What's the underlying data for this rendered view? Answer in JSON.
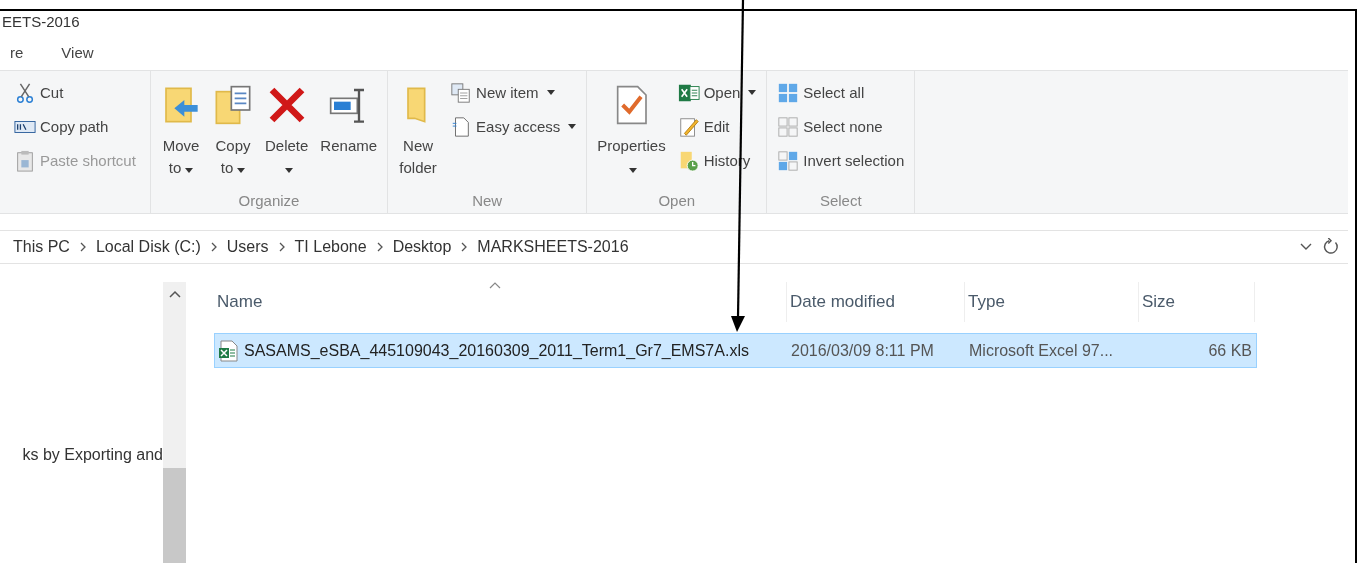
{
  "window": {
    "title": "EETS-2016"
  },
  "tabs": [
    {
      "label": "re",
      "selected": false
    },
    {
      "label": "View",
      "selected": false
    }
  ],
  "ribbon": {
    "groups": [
      {
        "items": [
          {
            "label": "Cut",
            "kind": "small",
            "disabled": false
          },
          {
            "label": "Copy path",
            "kind": "small",
            "disabled": false
          },
          {
            "label": "Paste shortcut",
            "kind": "small",
            "disabled": true
          }
        ]
      },
      {
        "label": "Organize",
        "items": [
          {
            "label": "Move to",
            "kind": "large",
            "dropdown": true
          },
          {
            "label": "Copy to",
            "kind": "large",
            "dropdown": true
          },
          {
            "label": "Delete",
            "kind": "large",
            "dropdown": true
          },
          {
            "label": "Rename",
            "kind": "large",
            "dropdown": false
          }
        ]
      },
      {
        "label": "New",
        "items": [
          {
            "label": "New folder",
            "kind": "large",
            "dropdown": false
          },
          {
            "label": "New item",
            "kind": "small",
            "dropdown": true,
            "disabled": false
          },
          {
            "label": "Easy access",
            "kind": "small",
            "dropdown": true,
            "disabled": false
          }
        ]
      },
      {
        "label": "Open",
        "items": [
          {
            "label": "Properties",
            "kind": "large",
            "dropdown": true
          },
          {
            "label": "Open",
            "kind": "small",
            "dropdown": true,
            "disabled": false
          },
          {
            "label": "Edit",
            "kind": "small",
            "disabled": false
          },
          {
            "label": "History",
            "kind": "small",
            "disabled": false
          }
        ]
      },
      {
        "label": "Select",
        "items": [
          {
            "label": "Select all",
            "kind": "small",
            "disabled": false
          },
          {
            "label": "Select none",
            "kind": "small",
            "disabled": false
          },
          {
            "label": "Invert selection",
            "kind": "small",
            "disabled": false
          }
        ]
      }
    ]
  },
  "address_bar": {
    "crumbs": [
      "This PC",
      "Local Disk (C:)",
      "Users",
      "TI Lebone",
      "Desktop",
      "MARKSHEETS-2016"
    ]
  },
  "navigation_pane": {
    "items": [
      "ks by Exporting and"
    ]
  },
  "file_list": {
    "columns": [
      "Name",
      "Date modified",
      "Type",
      "Size"
    ],
    "rows": [
      {
        "name": "SASAMS_eSBA_445109043_20160309_2011_Term1_Gr7_EMS7A.xls",
        "date_modified": "2016/03/09 8:11 PM",
        "type": "Microsoft Excel 97...",
        "size": "66 KB",
        "selected": true
      }
    ]
  }
}
